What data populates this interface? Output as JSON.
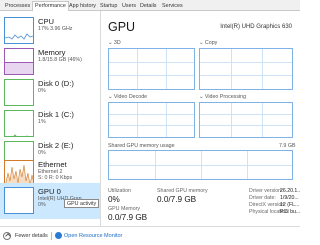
{
  "tabs": [
    "Processes",
    "Performance",
    "App history",
    "Startup",
    "Users",
    "Details",
    "Services"
  ],
  "active_tab": "Performance",
  "sidebar": {
    "items": [
      {
        "name": "CPU",
        "sub": "17% 3.96 GHz",
        "sub2": ""
      },
      {
        "name": "Memory",
        "sub": "1.8/15.8 GB (46%)",
        "sub2": ""
      },
      {
        "name": "Disk 0 (D:)",
        "sub": "0%",
        "sub2": ""
      },
      {
        "name": "Disk 1 (C:)",
        "sub": "1%",
        "sub2": ""
      },
      {
        "name": "Disk 2 (E:)",
        "sub": "0%",
        "sub2": ""
      },
      {
        "name": "Ethernet",
        "sub": "Ethernet 2",
        "sub2": "S: 0 R: 0 Kbps"
      },
      {
        "name": "GPU 0",
        "sub": "Intel(R) UHD Grap...",
        "sub2": "0%"
      }
    ],
    "tooltip": "GPU activity"
  },
  "gpu": {
    "title": "GPU",
    "model": "Intel(R) UHD Graphics 630",
    "engines": [
      "3D",
      "Copy",
      "Video Decode",
      "Video Processing"
    ],
    "shared_label": "Shared GPU memory usage",
    "shared_max": "7.9 GB",
    "stats": {
      "utilization_label": "Utilization",
      "utilization_value": "0%",
      "shared_mem_label": "Shared GPU memory",
      "shared_mem_value": "0.0/7.9 GB",
      "gpu_mem_label": "GPU Memory",
      "gpu_mem_value": "0.0/7.9 GB"
    },
    "info": [
      {
        "label": "Driver version:",
        "value": "26.20.1..."
      },
      {
        "label": "Driver date:",
        "value": "1/9/20..."
      },
      {
        "label": "DirectX version:",
        "value": "12 (FL..."
      },
      {
        "label": "Physical location:",
        "value": "PCI bu..."
      }
    ]
  },
  "footer": {
    "fewer_details": "Fewer details",
    "open_resource_monitor": "Open Resource Monitor"
  },
  "colors": {
    "graph_border": "#7eb3e8",
    "selected_bg": "#cce8ff",
    "ethernet_line": "#d17a2b",
    "link": "#1a6fc9"
  }
}
